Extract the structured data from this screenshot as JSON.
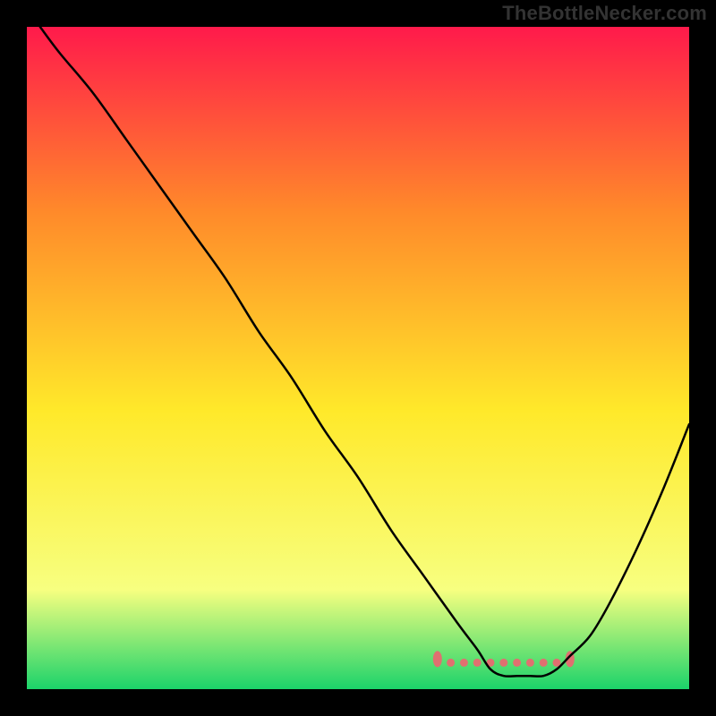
{
  "attribution": "TheBottleNecker.com",
  "chart_data": {
    "type": "line",
    "title": "",
    "xlabel": "",
    "ylabel": "",
    "xlim": [
      0,
      100
    ],
    "ylim": [
      0,
      100
    ],
    "grid": false,
    "legend": false,
    "background_gradient": {
      "top": "#ff1a4b",
      "mid_upper": "#ff8a2a",
      "mid": "#ffe92a",
      "mid_lower": "#f7ff80",
      "bottom": "#1bd36a"
    },
    "series": [
      {
        "name": "bottleneck-curve",
        "color": "#000000",
        "stroke_width": 2.5,
        "x": [
          2,
          5,
          10,
          15,
          20,
          25,
          30,
          35,
          40,
          45,
          50,
          55,
          60,
          65,
          68,
          70,
          72,
          74,
          76,
          78,
          80,
          82,
          85,
          88,
          92,
          96,
          100
        ],
        "y": [
          100,
          96,
          90,
          83,
          76,
          69,
          62,
          54,
          47,
          39,
          32,
          24,
          17,
          10,
          6,
          3,
          2,
          2,
          2,
          2,
          3,
          5,
          8,
          13,
          21,
          30,
          40
        ]
      }
    ],
    "markers": [
      {
        "name": "optimal-range-marker",
        "color": "#e07070",
        "shape": "dotted-band",
        "x": [
          62,
          82
        ],
        "y": [
          4,
          4
        ]
      }
    ]
  }
}
